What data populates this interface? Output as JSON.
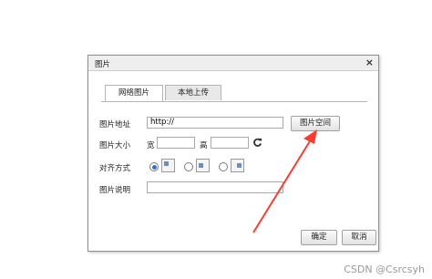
{
  "dialog": {
    "title": "图片",
    "close_label": "×",
    "tabs": [
      {
        "label": "网络图片",
        "active": true
      },
      {
        "label": "本地上传",
        "active": false
      }
    ],
    "fields": {
      "url_label": "图片地址",
      "url_value": "http://",
      "space_button": "图片空间",
      "size_label": "图片大小",
      "width_label": "宽",
      "height_label": "高",
      "align_label": "对齐方式",
      "align_selected": 0,
      "desc_label": "图片说明"
    },
    "buttons": {
      "ok": "确定",
      "cancel": "取消"
    }
  },
  "annotation": {
    "arrow_color": "#ff3b30"
  },
  "watermark": "CSDN @Csrcsyh"
}
